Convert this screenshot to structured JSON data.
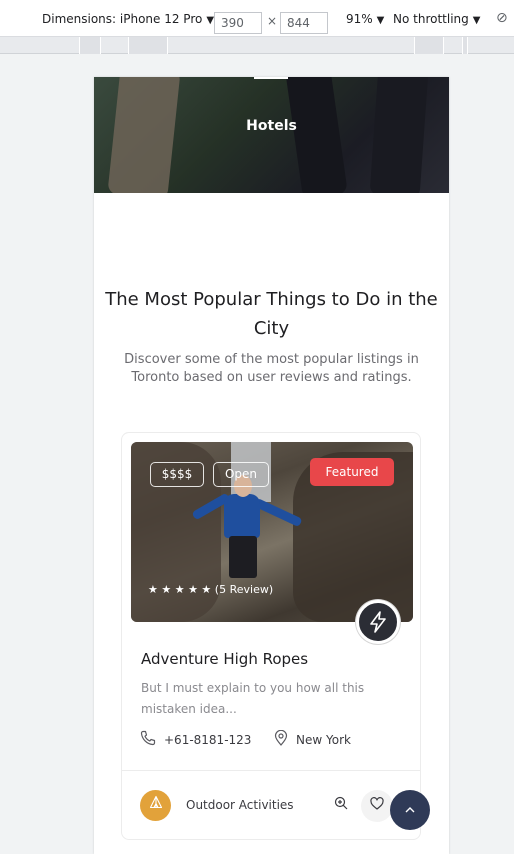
{
  "devtools": {
    "device_label": "Dimensions: iPhone 12 Pro",
    "width": "390",
    "times": "×",
    "height": "844",
    "zoom": "91%",
    "throttling": "No throttling"
  },
  "hero": {
    "title": "Hotels"
  },
  "section": {
    "title": "The Most Popular Things to Do in the City",
    "subtitle": "Discover some of the most popular listings in Toronto based on user reviews and ratings."
  },
  "listing": {
    "price": "$$$$",
    "status": "Open",
    "badge": "Featured",
    "stars": "★ ★ ★ ★ ★",
    "rating_value": 5,
    "reviews": "(5 Review)",
    "title": "Adventure High Ropes",
    "description": "But I must explain to you how all this mistaken idea...",
    "phone": "+61-8181-123",
    "location": "New York",
    "category": "Outdoor Activities"
  },
  "icons": {
    "bolt": "bolt-icon",
    "phone": "phone-icon",
    "location": "map-pin-icon",
    "category": "tent-icon",
    "zoom": "zoom-icon",
    "heart": "heart-icon",
    "to_top": "chevron-up-icon"
  },
  "colors": {
    "featured": "#e8474a",
    "category": "#e2a23a",
    "to_top": "#2f3a57"
  }
}
